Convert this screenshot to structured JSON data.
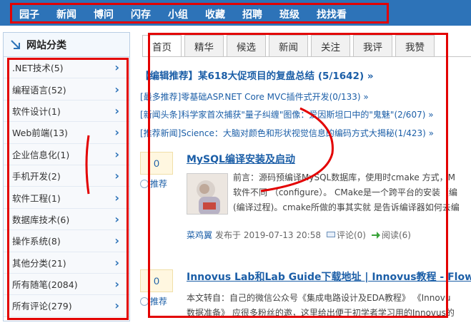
{
  "nav": {
    "items": [
      "园子",
      "新闻",
      "博问",
      "闪存",
      "小组",
      "收藏",
      "招聘",
      "班级",
      "找找看"
    ]
  },
  "sidebar": {
    "title": "网站分类",
    "items": [
      {
        "label": ".NET技术(5)"
      },
      {
        "label": "编程语言(52)"
      },
      {
        "label": "软件设计(1)"
      },
      {
        "label": "Web前端(13)"
      },
      {
        "label": "企业信息化(1)"
      },
      {
        "label": "手机开发(2)"
      },
      {
        "label": "软件工程(1)"
      },
      {
        "label": "数据库技术(6)"
      },
      {
        "label": "操作系统(8)"
      },
      {
        "label": "其他分类(21)"
      },
      {
        "label": "所有随笔(2084)"
      },
      {
        "label": "所有评论(279)"
      }
    ]
  },
  "tabs": [
    "首页",
    "精华",
    "候选",
    "新闻",
    "关注",
    "我评",
    "我赞"
  ],
  "headline": "【编辑推荐】某618大促项目的复盘总结 (5/1642) »",
  "picks": [
    "[最多推荐]零基础ASP.NET Core MVC插件式开发(0/133) »",
    "[新闻头条]科学家首次捕获\"量子纠缠\"图像：爱因斯坦口中的\"鬼魅\"(2/607) »",
    "[推荐新闻]Science：大脑对颜色和形状视觉信息的编码方式大揭秘(1/423) »"
  ],
  "posts": [
    {
      "votes": "0",
      "vote_label": "推荐",
      "title": "MySQL编译安装及启动",
      "body": [
        "前言：源码预编译MySQL数据库，使用时cmake 方式，M",
        "软件不同 （configure）。 CMake是一个跨平台的安装（编",
        "(编译过程)。cmake所做的事其实就 是告诉编译器如何去编"
      ],
      "author": "菜鸡翼",
      "published": "发布于 2019-07-13 20:58",
      "comments": "评论(0)",
      "reads": "阅读(6)"
    },
    {
      "votes": "0",
      "vote_label": "推荐",
      "title": "Innovus Lab和Lab Guide下载地址 | Innovus教程 - Flow系列",
      "body": [
        "本文转自：自己的微信公众号《集成电路设计及EDA教程》 《Innovu",
        "数据准备》 应很多粉丝的邀，这里给出便于初学者学习用的Innovus的"
      ]
    }
  ],
  "colors": {
    "nav_bg": "#2d73b8",
    "link": "#1b5ea7",
    "annotation": "#e30000"
  }
}
